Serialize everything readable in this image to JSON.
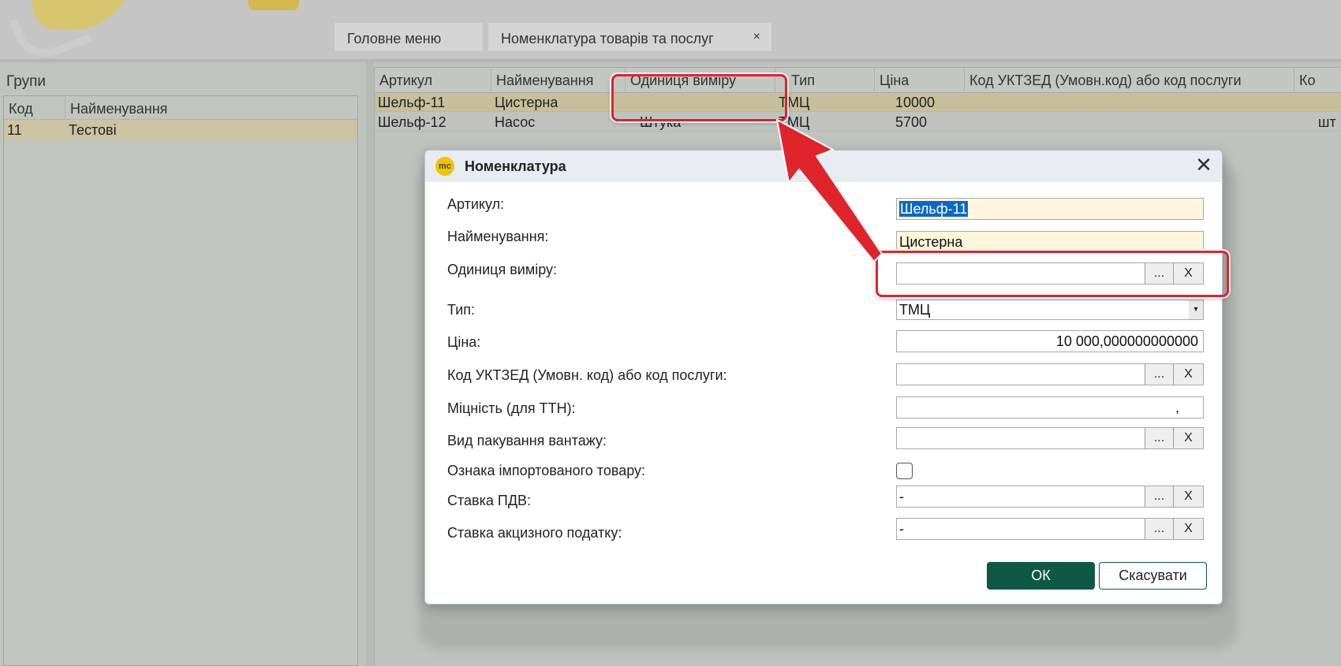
{
  "header": {
    "tabs": [
      {
        "label": "Головне меню"
      },
      {
        "label": "Номенклатура товарів та послуг",
        "close": "×"
      }
    ]
  },
  "groups": {
    "title": "Групи",
    "columns": [
      "Код",
      "Найменування"
    ],
    "rows": [
      {
        "code": "11",
        "name": "Тестові"
      }
    ]
  },
  "grid": {
    "columns": [
      "Артикул",
      "Найменування",
      "Одиниця виміру",
      "Тип",
      "Ціна",
      "Код УКТЗЕД (Умовн.код) або код послуги",
      "Ко"
    ],
    "rows": [
      {
        "article": "Шельф-11",
        "name": "Цистерна",
        "unit": "",
        "type": "ТМЦ",
        "price": "10000",
        "code": "",
        "extra": ""
      },
      {
        "article": "Шельф-12",
        "name": "Насос",
        "unit": "Штука",
        "type": "ТМЦ",
        "price": "5700",
        "code": "",
        "extra": "шт"
      }
    ]
  },
  "dialog": {
    "logo": "mc",
    "title": "Номенклатура",
    "close": "✕",
    "fields": {
      "article_label": "Артикул:",
      "article_value": "Шельф-11",
      "name_label": "Найменування:",
      "name_value": "Цистерна",
      "unit_label": "Одиниця виміру:",
      "unit_value": "",
      "type_label": "Тип:",
      "type_value": "ТМЦ",
      "price_label": "Ціна:",
      "price_value": "10 000,000000000000",
      "uktzed_label": "Код УКТЗЕД (Умовн. код) або код послуги:",
      "uktzed_value": "",
      "strength_label": "Міцність (для ТТН):",
      "strength_value": ",",
      "packing_label": "Вид пакування вантажу:",
      "packing_value": "",
      "imported_label": "Ознака імпортованого товару:",
      "imported_checked": false,
      "vat_label": "Ставка ПДВ:",
      "vat_value": "-",
      "excise_label": "Ставка акцизного податку:",
      "excise_value": "-"
    },
    "dots_label": "...",
    "clear_label": "X",
    "dropdown_icon": "▾",
    "ok_label": "ОК",
    "cancel_label": "Скасувати"
  },
  "colors": {
    "accent": "#0e5844",
    "selection_row": "#c7bf9b",
    "annotation": "#e0242c",
    "highlight_input": "#fef6dc"
  }
}
